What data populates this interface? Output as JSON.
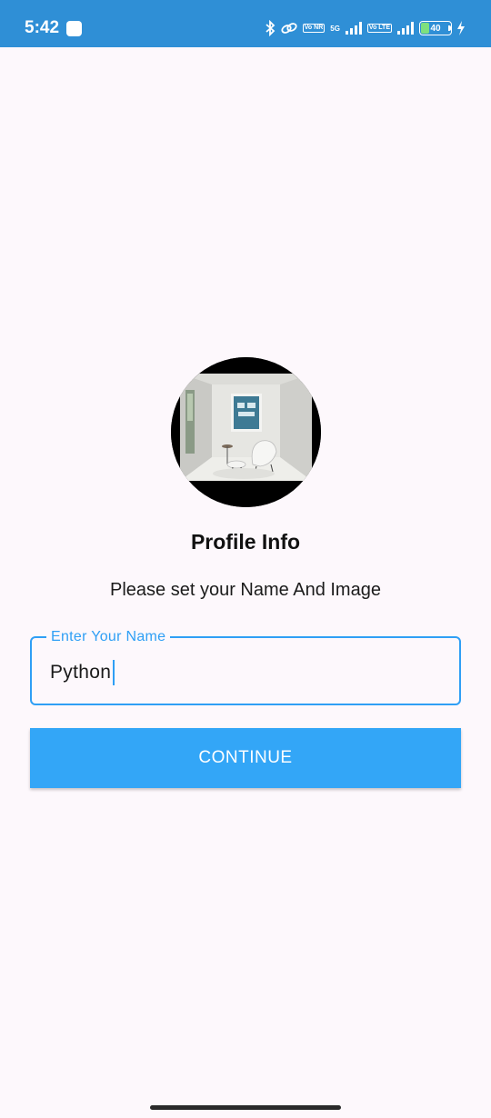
{
  "status_bar": {
    "time": "5:42",
    "network_badge_1": "Vo NR",
    "network_5g": "5G",
    "network_badge_2": "Vo LTE",
    "battery_level": "40",
    "background_color": "#2f8fd6"
  },
  "profile": {
    "title": "Profile Info",
    "subtitle": "Please set your Name And Image",
    "avatar_icon": "profile-image"
  },
  "name_field": {
    "label": "Enter Your Name",
    "value": "Python",
    "accent_color": "#2f9ff5"
  },
  "continue_button": {
    "label": "CONTINUE",
    "color": "#33a6f7"
  }
}
